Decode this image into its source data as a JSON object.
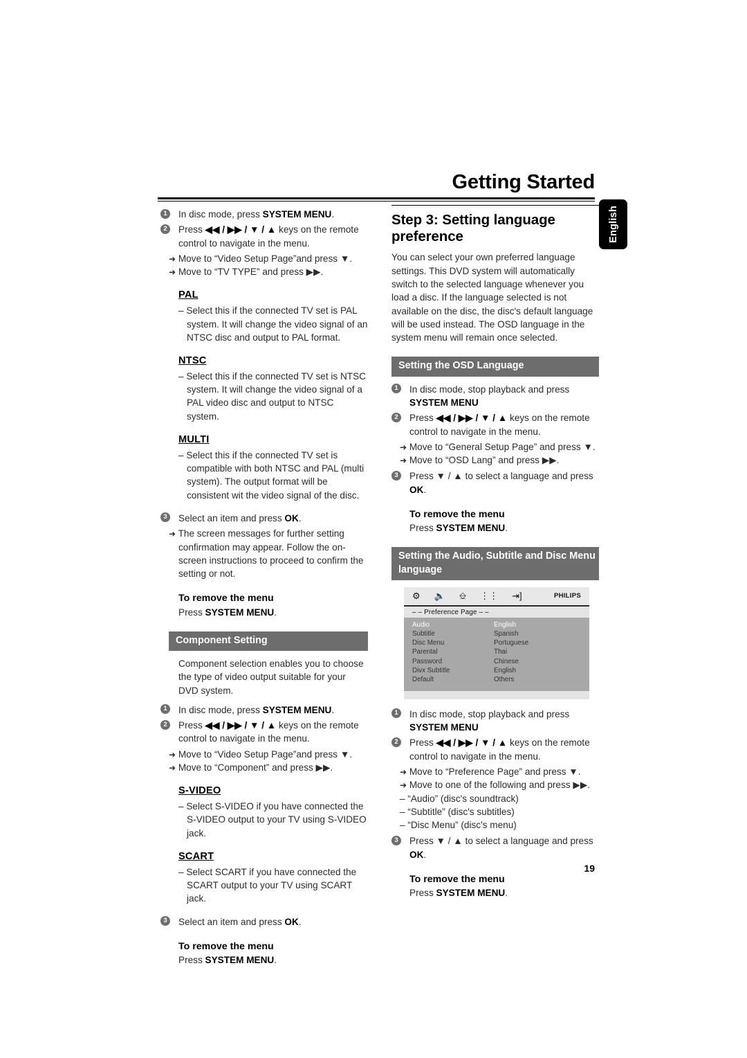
{
  "header": {
    "title": "Getting Started",
    "language_tab": "English",
    "page_number": "19"
  },
  "left_column": {
    "tv_type_steps": [
      {
        "num": "1",
        "text_pre": "In disc mode, press ",
        "bold": "SYSTEM MENU",
        "text_post": "."
      },
      {
        "num": "2",
        "text_pre": "Press ",
        "keys": "◀◀ / ▶▶ / ▼ / ▲",
        "text_post": " keys on the remote control to navigate in the menu."
      }
    ],
    "tv_type_arrows": [
      "Move to “Video Setup Page”and press ▼.",
      "Move to “TV TYPE” and press ▶▶."
    ],
    "options": [
      {
        "title": "PAL",
        "body": "–   Select this if the connected TV set is PAL system. It will change the video signal of an NTSC disc and output to PAL format."
      },
      {
        "title": "NTSC",
        "body": "–   Select this if the connected TV set is NTSC system. It will change the video signal of a PAL video disc and output to NTSC system."
      },
      {
        "title": "MULTI",
        "body": "–   Select this if the connected TV set is compatible with both NTSC and PAL (multi system). The output format will be consistent wit the video signal of the disc."
      }
    ],
    "step3": {
      "num": "3",
      "text_pre": "Select an item and press ",
      "bold": "OK",
      "text_post": "."
    },
    "step3_arrow": "The screen messages for further setting confirmation may appear. Follow the on-screen instructions to proceed to confirm the setting or not.",
    "remove_menu_1": {
      "heading": "To remove the menu",
      "text_pre": "Press ",
      "bold": "SYSTEM MENU",
      "text_post": "."
    },
    "component_bar": "Component Setting",
    "component_intro": "Component selection enables you to choose the type of video output suitable for your DVD system.",
    "component_steps": [
      {
        "num": "1",
        "text_pre": "In disc mode, press ",
        "bold": "SYSTEM MENU",
        "text_post": "."
      },
      {
        "num": "2",
        "text_pre": "Press ",
        "keys": "◀◀ / ▶▶ / ▼ / ▲",
        "text_post": " keys on the remote control to navigate in the menu."
      }
    ],
    "component_arrows": [
      "Move to “Video Setup Page”and press ▼.",
      "Move to “Component” and press ▶▶."
    ],
    "component_options": [
      {
        "title": "S-VIDEO",
        "body": "– Select S-VIDEO if you have connected the S-VIDEO output to your TV using S-VIDEO jack."
      },
      {
        "title": "SCART",
        "body": "– Select SCART if you have connected the SCART output to your TV using SCART jack."
      }
    ],
    "component_step3": {
      "num": "3",
      "text_pre": "Select an item and press ",
      "bold": "OK",
      "text_post": "."
    },
    "remove_menu_2": {
      "heading": "To remove the menu",
      "text_pre": "Press ",
      "bold": "SYSTEM MENU",
      "text_post": "."
    }
  },
  "right_column": {
    "section_title": "Step 3: Setting language preference",
    "intro": "You can select your own preferred language settings. This DVD system will automatically switch to the selected language whenever you load a disc. If the language selected is not available on the disc, the disc's default language will be used instead. The OSD language in the system menu will remain once selected.",
    "osd_bar": "Setting the OSD Language",
    "osd_steps": [
      {
        "num": "1",
        "text_pre": "In disc mode,  stop playback and press ",
        "bold": "SYSTEM MENU",
        "text_post": ""
      },
      {
        "num": "2",
        "text_pre": "Press ",
        "keys": "◀◀ / ▶▶ / ▼ / ▲",
        "text_post": " keys on the remote control to navigate in the menu."
      }
    ],
    "osd_arrows": [
      "Move to “General Setup Page” and press ▼.",
      "Move to “OSD Lang” and press ▶▶."
    ],
    "osd_step3": {
      "num": "3",
      "text_pre": "Press ▼ / ▲ to select a language and press ",
      "bold": "OK",
      "text_post": "."
    },
    "remove_menu_1": {
      "heading": "To remove the menu",
      "text_pre": "Press ",
      "bold": "SYSTEM MENU",
      "text_post": "."
    },
    "audio_bar": "Setting the Audio,  Subtitle and Disc Menu language",
    "osd_screenshot": {
      "icons": [
        "gear-icon",
        "speaker-icon",
        "keyboard-icon",
        "dots-icon",
        "exit-icon"
      ],
      "brand": "PHILIPS",
      "page_label": "– –  Preference Page  – –",
      "rows": [
        {
          "key": "Audio",
          "value": "English",
          "selected": true
        },
        {
          "key": "Subtitle",
          "value": "Spanish",
          "selected": false
        },
        {
          "key": "Disc Menu",
          "value": "Portuguese",
          "selected": false
        },
        {
          "key": "Parental",
          "value": "Thai",
          "selected": false
        },
        {
          "key": "Password",
          "value": "Chinese",
          "selected": false
        },
        {
          "key": "Divx Subtitle",
          "value": "English",
          "selected": false
        },
        {
          "key": "Default",
          "value": "Others",
          "selected": false
        }
      ]
    },
    "audio_steps": [
      {
        "num": "1",
        "text_pre": "In disc mode,  stop playback and press ",
        "bold": "SYSTEM MENU",
        "text_post": ""
      },
      {
        "num": "2",
        "text_pre": "Press ",
        "keys": "◀◀ / ▶▶ / ▼ / ▲",
        "text_post": " keys on the remote control to navigate in the menu."
      }
    ],
    "audio_arrows": [
      "Move to “Preference Page” and press ▼.",
      "Move to one of the following and press ▶▶."
    ],
    "audio_dashes": [
      "–   “Audio” (disc's soundtrack)",
      "–   “Subtitle” (disc's subtitles)",
      "–   “Disc Menu” (disc's menu)"
    ],
    "audio_step3": {
      "num": "3",
      "text_pre": "Press ▼ / ▲ to select a language and press ",
      "bold": "OK",
      "text_post": "."
    },
    "remove_menu_2": {
      "heading": "To remove the menu",
      "text_pre": "Press ",
      "bold": "SYSTEM MENU",
      "text_post": "."
    }
  },
  "colors": {
    "section_bar": "#6d6d6d",
    "bullet": "#6e6e6e",
    "osd_body": "#a8a8a8",
    "tab": "#000000"
  }
}
